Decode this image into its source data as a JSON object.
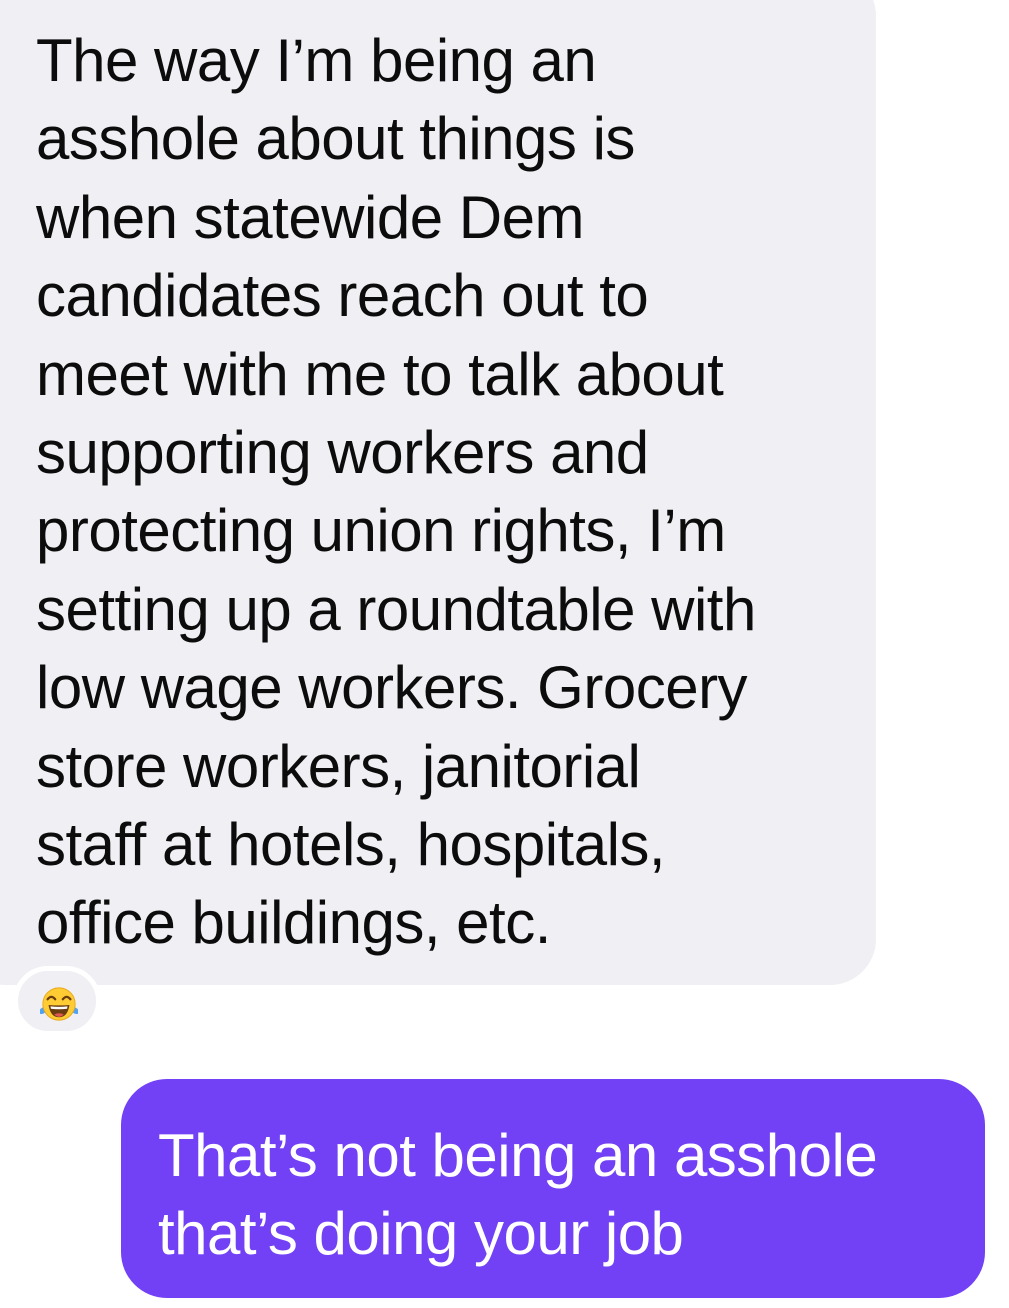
{
  "conversation": {
    "messages": [
      {
        "direction": "incoming",
        "text": "The way I’m being an\nasshole about things is\nwhen statewide Dem\ncandidates reach out to\nmeet with me to talk about\nsupporting workers and\nprotecting union rights, I’m\nsetting up a roundtable with\nlow wage workers. Grocery\nstore workers, janitorial\nstaff at hotels, hospitals,\noffice buildings, etc.",
        "reaction": {
          "icon": "tears-of-joy-emoji-icon"
        }
      },
      {
        "direction": "outgoing",
        "text": "That’s not being an asshole\nthat’s doing your job"
      }
    ]
  },
  "colors": {
    "incoming_bubble": "#efeff4",
    "outgoing_bubble": "#7240f5",
    "incoming_text": "#0c0c0c",
    "outgoing_text": "#ffffff"
  }
}
